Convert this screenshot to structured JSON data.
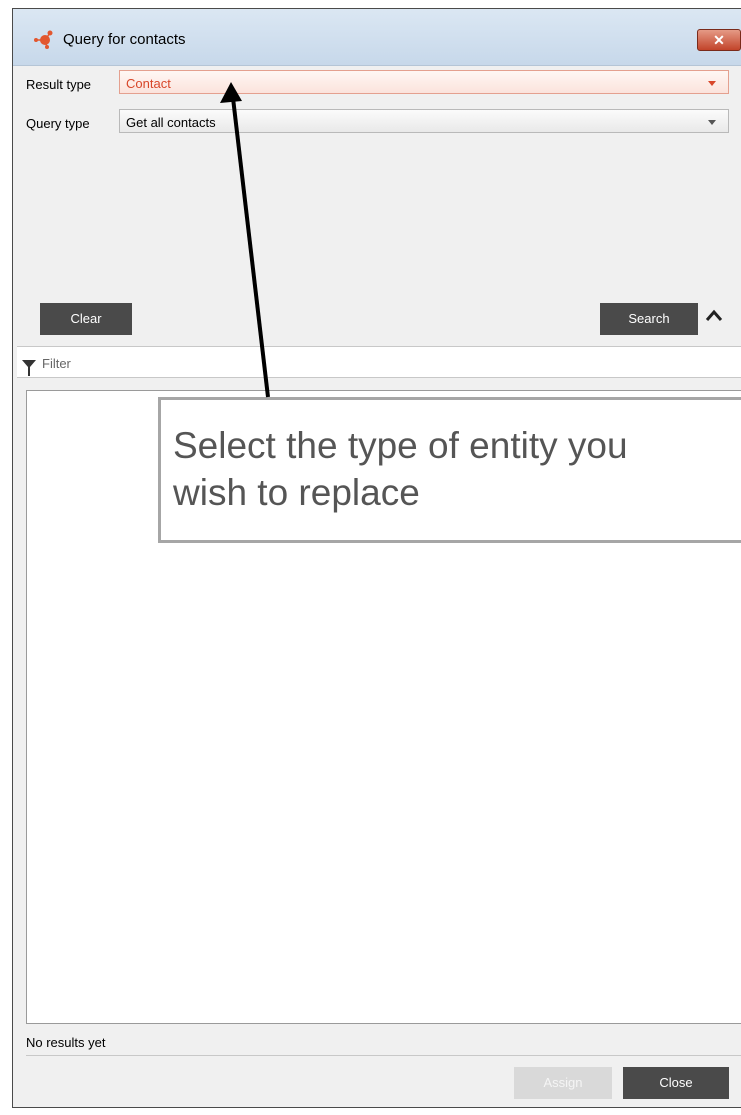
{
  "window": {
    "title": "Query for contacts",
    "close_glyph": "✕"
  },
  "form": {
    "result_type": {
      "label": "Result type",
      "value": "Contact",
      "icon": "chevron-down-icon"
    },
    "query_type": {
      "label": "Query type",
      "value": "Get all contacts",
      "icon": "chevron-down-icon"
    }
  },
  "actions": {
    "clear": "Clear",
    "search": "Search",
    "collapse_icon": "chevron-up-icon"
  },
  "filter": {
    "placeholder": "Filter",
    "icon": "funnel-icon"
  },
  "status": {
    "text": "No results yet"
  },
  "footer": {
    "assign": "Assign",
    "close": "Close"
  },
  "callout": {
    "text": "Select the type of entity you\nwish to replace"
  },
  "colors": {
    "accent": "#d8472a",
    "dark_button": "#4a4a4a",
    "titlebar": "#cfdeee"
  }
}
